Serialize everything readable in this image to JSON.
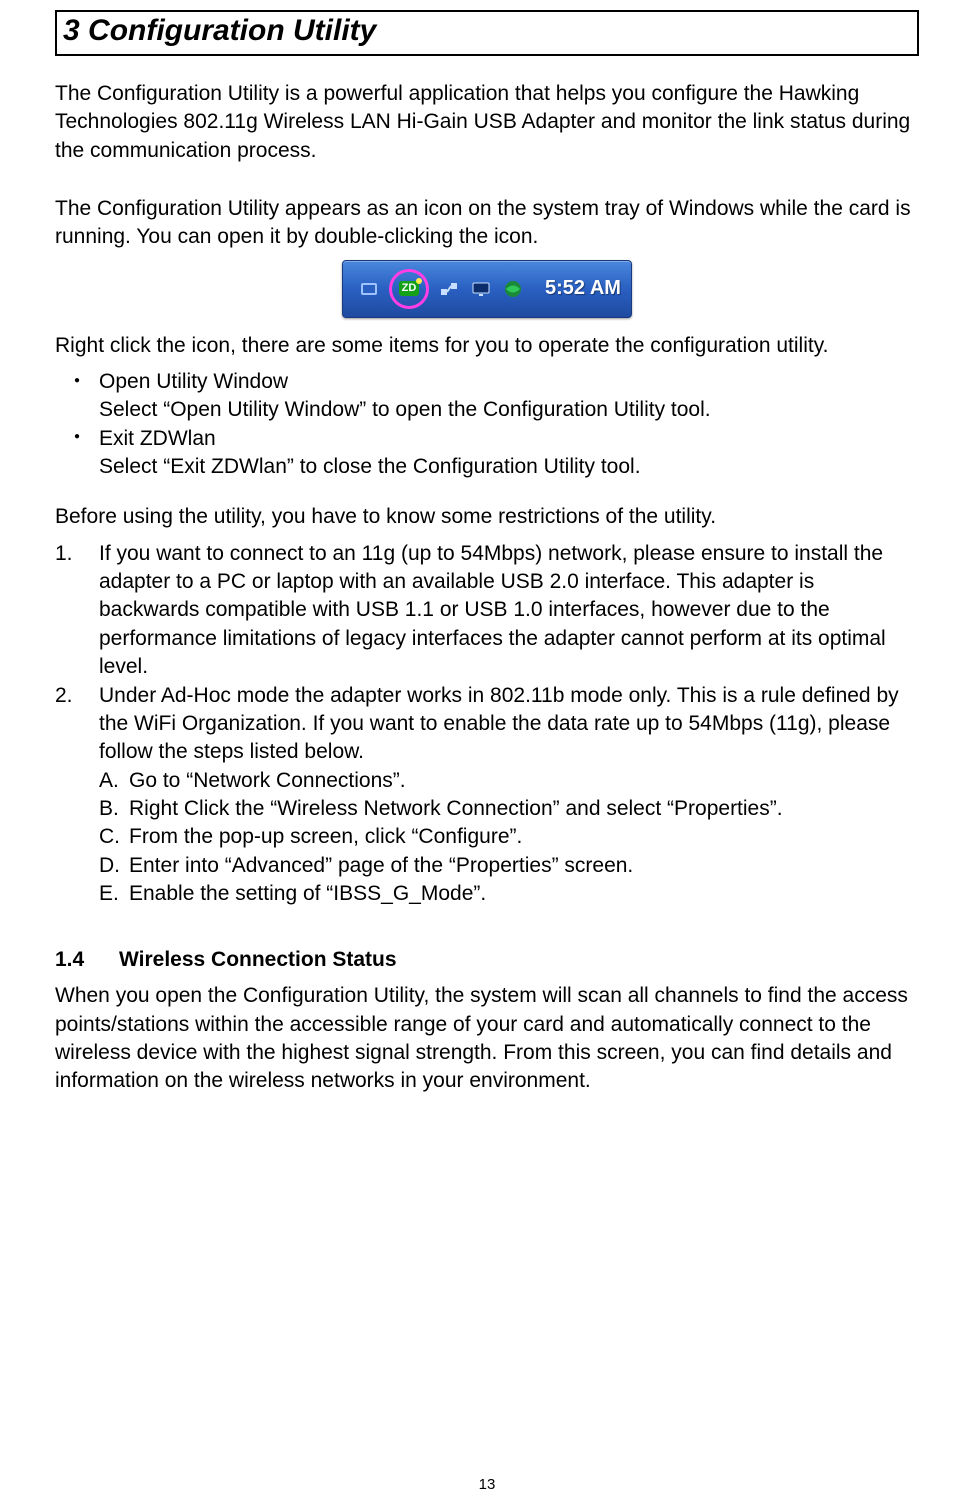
{
  "chapter": {
    "number": "3",
    "title": "Configuration Utility"
  },
  "intro": {
    "p1": "The Configuration Utility is a powerful application that helps you configure the Hawking Technologies 802.11g Wireless LAN Hi-Gain USB Adapter and monitor the link status during the communication process.",
    "p2": "The Configuration Utility appears as an icon on the system tray of Windows while the card is running. You can open it by double-clicking the icon."
  },
  "tray": {
    "zd_label": "ZD",
    "clock": "5:52 AM"
  },
  "right_click_intro": "Right click the icon, there are some items for you to operate the configuration utility.",
  "menu_items": [
    {
      "title": "Open Utility Window",
      "desc": "Select “Open Utility Window” to open the Configuration Utility tool."
    },
    {
      "title": "Exit ZDWlan",
      "desc": "Select “Exit ZDWlan” to close the Configuration Utility tool."
    }
  ],
  "restrictions_intro": "Before using the utility, you have to know some restrictions of the utility.",
  "restrictions": [
    {
      "num": "1.",
      "text": "If you want to connect to an 11g (up to 54Mbps) network, please ensure to install the adapter to a PC or laptop with an available USB 2.0 interface. This adapter is backwards compatible with USB 1.1 or USB 1.0 interfaces, however due to the performance limitations of legacy interfaces the adapter cannot perform at its optimal level."
    },
    {
      "num": "2.",
      "text": "Under Ad-Hoc mode the adapter works in 802.11b mode only. This is a rule defined by the WiFi Organization. If you want to enable the data rate up to 54Mbps (11g), please follow the steps listed below.",
      "substeps": [
        {
          "letter": "A.",
          "text": "Go to “Network Connections”."
        },
        {
          "letter": "B.",
          "text": "Right Click the “Wireless Network Connection” and select “Properties”."
        },
        {
          "letter": "C.",
          "text": "From the pop-up screen, click “Configure”."
        },
        {
          "letter": "D.",
          "text": "Enter into “Advanced” page of the “Properties” screen."
        },
        {
          "letter": "E.",
          "text": "Enable the setting of “IBSS_G_Mode”."
        }
      ]
    }
  ],
  "section": {
    "number": "1.4",
    "title": "Wireless Connection Status",
    "body": "When you open the Configuration Utility, the system will scan all channels to find the access points/stations within the accessible range of your card and automatically connect to the wireless device with the highest signal strength. From this screen, you can find details and information on the wireless networks in your environment."
  },
  "page_number": "13"
}
